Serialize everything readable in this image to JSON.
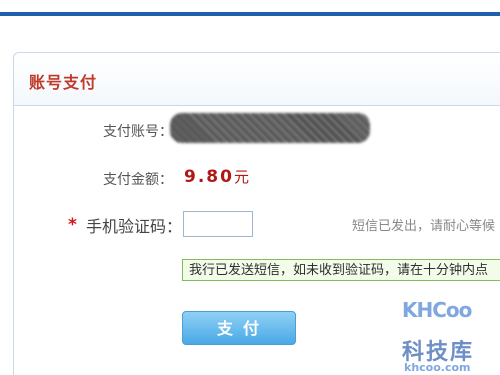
{
  "panel": {
    "title": "账号支付"
  },
  "account": {
    "label": "支付账号："
  },
  "amount": {
    "label": "支付金额：",
    "value": "9.80",
    "unit": "元"
  },
  "phone_code": {
    "required_mark": "*",
    "label": "手机验证码：",
    "value": "",
    "hint": "短信已发出，请耐心等候"
  },
  "notice": {
    "text": "我行已发送短信，如未收到验证码，请在十分钟内点"
  },
  "actions": {
    "pay_label": "支付"
  },
  "watermark": {
    "logo": "KHCoo",
    "brand": "科技库",
    "url": "khcoo.com"
  },
  "colors": {
    "accent": "#1f5fae",
    "title": "#c0392b",
    "amount": "#b01818",
    "button": "#49a9e6",
    "notice_border": "#7cbf58"
  }
}
